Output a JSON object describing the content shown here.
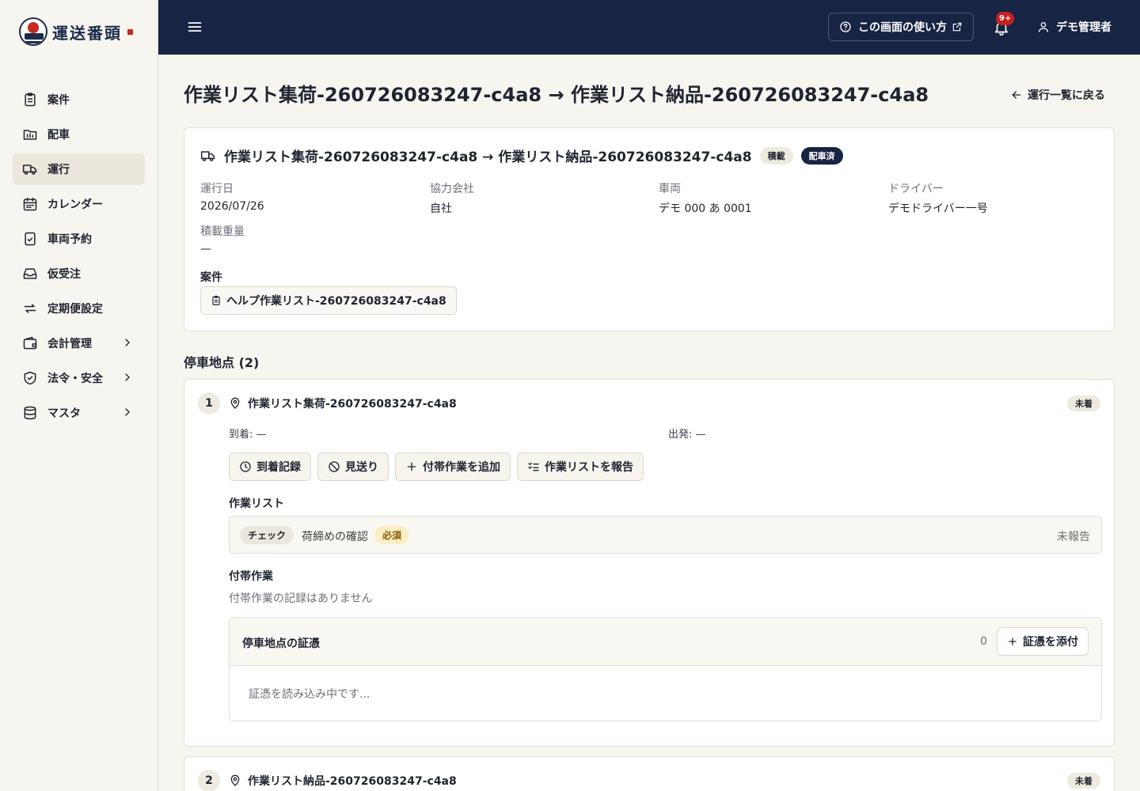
{
  "brand": {
    "name": "運送番頭"
  },
  "sidebar": {
    "items": [
      {
        "label": "案件",
        "icon": "clipboard-icon"
      },
      {
        "label": "配車",
        "icon": "dispatch-board-icon"
      },
      {
        "label": "運行",
        "icon": "truck-icon",
        "active": true
      },
      {
        "label": "カレンダー",
        "icon": "calendar-icon"
      },
      {
        "label": "車両予約",
        "icon": "clipboard-check-icon"
      },
      {
        "label": "仮受注",
        "icon": "inbox-icon"
      },
      {
        "label": "定期便設定",
        "icon": "repeat-icon"
      },
      {
        "label": "会計管理",
        "icon": "wallet-icon",
        "expandable": true
      },
      {
        "label": "法令・安全",
        "icon": "shield-check-icon",
        "expandable": true
      },
      {
        "label": "マスタ",
        "icon": "database-icon",
        "expandable": true
      }
    ]
  },
  "header": {
    "help_label": "この画面の使い方",
    "notification_count": "9+",
    "user_name": "デモ管理者"
  },
  "page": {
    "title": "作業リスト集荷-260726083247-c4a8 → 作業リスト納品-260726083247-c4a8",
    "back_label": "運行一覧に戻る"
  },
  "summary": {
    "title": "作業リスト集荷-260726083247-c4a8 → 作業リスト納品-260726083247-c4a8",
    "badge_loaded": "積載",
    "badge_status": "配車済",
    "fields": {
      "date_label": "運行日",
      "date_value": "2026/07/26",
      "partner_label": "協力会社",
      "partner_value": "自社",
      "vehicle_label": "車両",
      "vehicle_value": "デモ 000 あ 0001",
      "driver_label": "ドライバー",
      "driver_value": "デモドライバー一号",
      "weight_label": "積載重量",
      "weight_value": "—"
    },
    "case_label": "案件",
    "case_chip": "ヘルプ作業リスト-260726083247-c4a8"
  },
  "stops": {
    "title": "停車地点 (2)",
    "stop1": {
      "number": "1",
      "name": "作業リスト集荷-260726083247-c4a8",
      "status": "未着",
      "arrival": "到着: —",
      "departure": "出発: —",
      "actions": {
        "arrive": "到着記録",
        "skip": "見送り",
        "add_extra": "付帯作業を追加",
        "report": "作業リストを報告"
      },
      "worklist_label": "作業リスト",
      "worklist_item": {
        "type": "チェック",
        "text": "荷締めの確認",
        "required": "必須",
        "status": "未報告"
      },
      "extra_label": "付帯作業",
      "extra_empty": "付帯作業の記録はありません",
      "evidence": {
        "title": "停車地点の証憑",
        "count": "0",
        "attach": "証憑を添付",
        "loading": "証憑を読み込み中です..."
      }
    },
    "stop2": {
      "number": "2",
      "name": "作業リスト納品-260726083247-c4a8",
      "status": "未着"
    }
  }
}
